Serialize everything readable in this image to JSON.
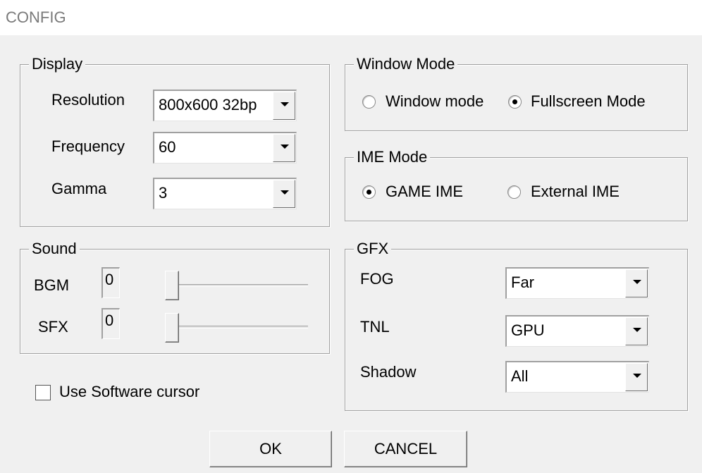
{
  "window": {
    "title": "CONFIG"
  },
  "display": {
    "legend": "Display",
    "resolution_label": "Resolution",
    "resolution_value": "800x600 32bp",
    "frequency_label": "Frequency",
    "frequency_value": "60",
    "gamma_label": "Gamma",
    "gamma_value": "3"
  },
  "window_mode": {
    "legend": "Window Mode",
    "options": [
      "Window mode",
      "Fullscreen Mode"
    ],
    "selected": "Fullscreen Mode"
  },
  "ime_mode": {
    "legend": "IME Mode",
    "options": [
      "GAME IME",
      "External IME"
    ],
    "selected": "GAME IME"
  },
  "sound": {
    "legend": "Sound",
    "bgm_label": "BGM",
    "bgm_value": "0",
    "sfx_label": "SFX",
    "sfx_value": "0"
  },
  "gfx": {
    "legend": "GFX",
    "fog_label": "FOG",
    "fog_value": "Far",
    "tnl_label": "TNL",
    "tnl_value": "GPU",
    "shadow_label": "Shadow",
    "shadow_value": "All"
  },
  "software_cursor": {
    "label": "Use Software cursor",
    "checked": false
  },
  "buttons": {
    "ok": "OK",
    "cancel": "CANCEL"
  },
  "colors": {
    "background": "#f0f0f0",
    "titlebar": "#ffffff",
    "title_text": "#7a7a7a",
    "border": "#a0a0a0"
  },
  "icons": {
    "combo_arrow": "chevron-down-icon"
  }
}
